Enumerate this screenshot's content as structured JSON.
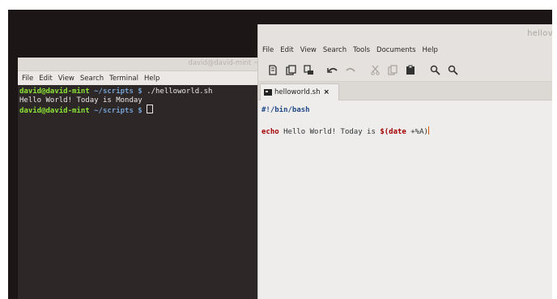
{
  "terminal": {
    "title": "david@david-mint ~",
    "menu": [
      "File",
      "Edit",
      "View",
      "Search",
      "Terminal",
      "Help"
    ],
    "lines": [
      {
        "prompt": "david@david-mint",
        "path": "~/scripts $",
        "cmd": "./helloworld.sh"
      },
      {
        "output": "Hello World! Today is Monday"
      },
      {
        "prompt": "david@david-mint",
        "path": "~/scripts $"
      }
    ]
  },
  "editor": {
    "title": "hellov",
    "menu": [
      "File",
      "Edit",
      "View",
      "Search",
      "Tools",
      "Documents",
      "Help"
    ],
    "toolbar": [
      "new-file-icon",
      "open-icon",
      "save-icon",
      "undo-icon",
      "redo-icon",
      "cut-icon",
      "copy-icon",
      "paste-icon",
      "search-icon",
      "search-replace-icon"
    ],
    "tab": {
      "label": "helloworld.sh",
      "close": "×"
    },
    "code": {
      "line1": "#!/bin/bash",
      "line2_kw": "echo",
      "line2_text": " Hello World! Today is ",
      "line2_dollar": "$(",
      "line2_cmd": "date",
      "line2_arg": " +%A)"
    }
  }
}
